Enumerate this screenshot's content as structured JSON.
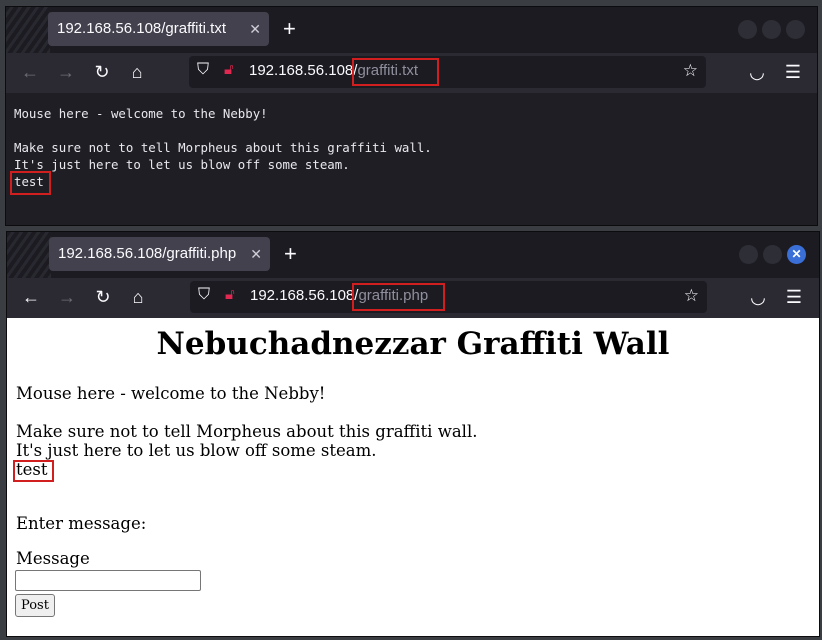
{
  "window1": {
    "tab_title": "192.168.56.108/graffiti.txt",
    "url_host": "192.168.56.108/",
    "url_path": "graffiti.txt",
    "content_lines": [
      "Mouse here - welcome to the Nebby!",
      "",
      "Make sure not to tell Morpheus about this graffiti wall.",
      "It's just here to let us blow off some steam.",
      "test"
    ]
  },
  "window2": {
    "tab_title": "192.168.56.108/graffiti.php",
    "url_host": "192.168.56.108/",
    "url_path": "graffiti.php",
    "heading": "Nebuchadnezzar Graffiti Wall",
    "line1": "Mouse here - welcome to the Nebby!",
    "line2": "Make sure not to tell Morpheus about this graffiti wall.",
    "line3": "It's just here to let us blow off some steam.",
    "line4": "test",
    "enter_message": "Enter message:",
    "message_label": "Message",
    "message_value": "",
    "post_label": "Post"
  },
  "icons": {
    "tab_close": "close-icon",
    "new_tab": "plus-icon",
    "back": "arrow-left-icon",
    "forward": "arrow-right-icon",
    "reload": "reload-icon",
    "home": "home-icon",
    "shield": "shield-icon",
    "lock": "insecure-lock-icon",
    "star": "star-icon",
    "pocket": "pocket-icon",
    "menu": "hamburger-menu-icon"
  },
  "colors": {
    "highlight": "#d11e1e",
    "window_close_active": "#3a6fd8"
  }
}
